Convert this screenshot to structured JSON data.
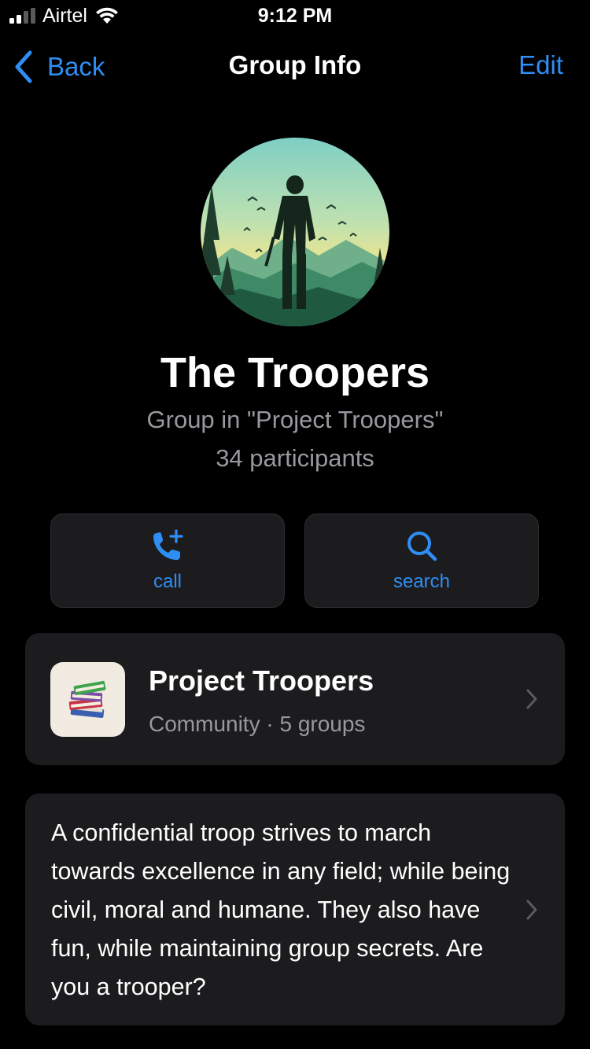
{
  "status_bar": {
    "carrier": "Airtel",
    "time": "9:12 PM"
  },
  "nav": {
    "back_label": "Back",
    "title": "Group Info",
    "edit_label": "Edit"
  },
  "group": {
    "name": "The Troopers",
    "subtitle": "Group in \"Project Troopers\"",
    "participants": "34 participants"
  },
  "actions": [
    {
      "label": "call",
      "icon": "phone-plus-icon"
    },
    {
      "label": "search",
      "icon": "search-icon"
    }
  ],
  "community": {
    "name": "Project Troopers",
    "subtitle": "Community · 5 groups",
    "icon": "books-icon"
  },
  "description": {
    "text": "A confidential troop strives to march towards excellence in any field; while being civil, moral and humane. They also have fun, while maintaining group secrets. Are you a trooper?"
  },
  "colors": {
    "accent": "#2f8ef4",
    "background": "#000000",
    "card": "#1c1c1e",
    "secondary_text": "#98989f"
  }
}
